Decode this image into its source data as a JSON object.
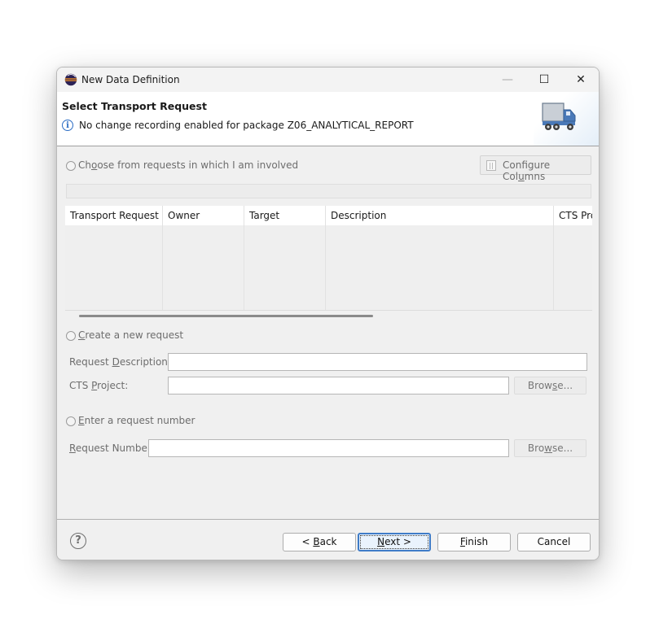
{
  "window": {
    "title": "New Data Definition",
    "controls": {
      "minimize": "—",
      "maximize": "☐",
      "close": "✕"
    }
  },
  "header": {
    "title": "Select Transport Request",
    "message": "No change recording enabled for package Z06_ANALYTICAL_REPORT",
    "info_icon": "i",
    "banner_icon": "truck-icon"
  },
  "involved": {
    "label_pre": "Ch",
    "label_key": "o",
    "label_post": "ose from requests in which I am involved",
    "configure_pre": "Configure Col",
    "configure_key": "u",
    "configure_post": "mns"
  },
  "table": {
    "columns": [
      "Transport Request",
      "Owner",
      "Target",
      "Description",
      "CTS Pro"
    ],
    "rows": []
  },
  "create": {
    "label_key": "C",
    "label_post": "reate a new request",
    "desc_pre": "Request ",
    "desc_key": "D",
    "desc_post": "escription: *",
    "desc_value": "",
    "project_pre": "CTS ",
    "project_key": "P",
    "project_post": "roject:",
    "project_value": "",
    "browse_pre": "Brow",
    "browse_key": "s",
    "browse_post": "e..."
  },
  "enter": {
    "label_key": "E",
    "label_post": "nter a request number",
    "number_key": "R",
    "number_post": "equest Number:",
    "number_value": "",
    "browse_pre": "Bro",
    "browse_key": "w",
    "browse_post": "se..."
  },
  "footer": {
    "help": "?",
    "back_pre": "< ",
    "back_key": "B",
    "back_post": "ack",
    "next_key": "N",
    "next_post": "ext >",
    "finish_key": "F",
    "finish_post": "inish",
    "cancel": "Cancel"
  }
}
